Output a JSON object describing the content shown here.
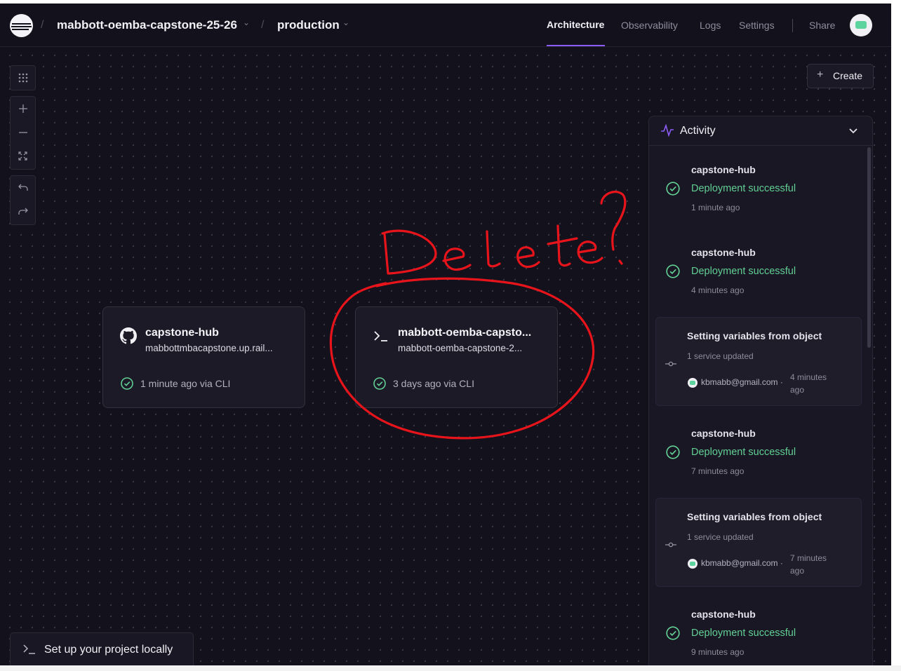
{
  "header": {
    "project_name": "mabbott-oemba-capstone-25-26",
    "environment": "production",
    "separator": "/",
    "nav": [
      "Architecture",
      "Observability",
      "Logs",
      "Settings"
    ],
    "active_nav": "Architecture",
    "share_label": "Share"
  },
  "toolbar": {
    "create_label": "Create",
    "tools": [
      "grid-icon",
      "zoom-in-icon",
      "zoom-out-icon",
      "fit-view-icon",
      "undo-icon",
      "redo-icon"
    ]
  },
  "services": [
    {
      "name": "capstone-hub",
      "subtitle": "mabbottmbacapstone.up.rail...",
      "icon": "github-icon",
      "status": "1 minute ago via CLI"
    },
    {
      "name": "mabbott-oemba-capsto...",
      "subtitle": "mabbott-oemba-capstone-2...",
      "icon": "terminal-icon",
      "status": "3 days ago via CLI"
    }
  ],
  "activity": {
    "title": "Activity",
    "items": [
      {
        "type": "deploy",
        "service": "capstone-hub",
        "status": "Deployment successful",
        "time": "1 minute ago"
      },
      {
        "type": "deploy",
        "service": "capstone-hub",
        "status": "Deployment successful",
        "time": "4 minutes ago"
      },
      {
        "type": "variables",
        "title": "Setting variables from object",
        "detail": "1 service updated",
        "user": "kbmabb@gmail.com",
        "dot": "·",
        "time_line1": "4 minutes",
        "time_line2": "ago"
      },
      {
        "type": "deploy",
        "service": "capstone-hub",
        "status": "Deployment successful",
        "time": "7 minutes ago"
      },
      {
        "type": "variables",
        "title": "Setting variables from object",
        "detail": "1 service updated",
        "user": "kbmabb@gmail.com",
        "dot": "·",
        "time_line1": "7 minutes",
        "time_line2": "ago"
      },
      {
        "type": "deploy",
        "service": "capstone-hub",
        "status": "Deployment successful",
        "time": "9 minutes ago"
      }
    ]
  },
  "footer": {
    "setup_label": "Set up your project locally"
  },
  "annotation": {
    "text": "Delete?",
    "color": "#e8141b"
  },
  "colors": {
    "background": "#13111c",
    "accent": "#8b5cf6",
    "success": "#62cf95",
    "card": "#1c1a26"
  }
}
